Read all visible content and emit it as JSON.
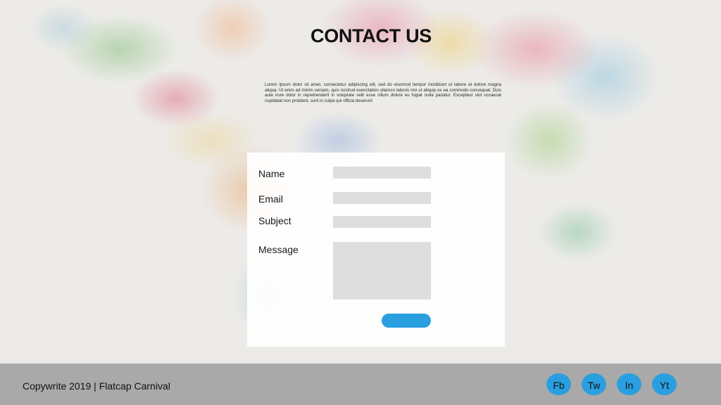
{
  "page": {
    "title": "CONTACT US",
    "intro": "Lorem ipsum dolor sit amet, consectetur adipiscing elit, sed do eiusmod tempor incididunt ut labore et dolore magna aliqua. Ut enim ad minim veniam, quis nostrud exercitation ullamco laboris nisi ut aliquip ex ea commodo consequat. Duis aute irure dolor in reprehenderit in voluptate velit esse cillum dolore eu fugiat nulla pariatur. Excepteur sint occaecat cupidatat non proident, sunt in culpa qui officia deserunt"
  },
  "form": {
    "name_label": "Name",
    "email_label": "Email",
    "subject_label": "Subject",
    "message_label": "Message",
    "name_value": "",
    "email_value": "",
    "subject_value": "",
    "message_value": "",
    "submit_label": ""
  },
  "footer": {
    "copyright": "Copywrite 2019 | Flatcap Carnival",
    "social": {
      "facebook": "Fb",
      "twitter": "Tw",
      "linkedin": "In",
      "youtube": "Yt"
    }
  },
  "colors": {
    "accent": "#2a9fe0",
    "footer_bg": "#a9a9a9",
    "field_bg": "#dedede"
  }
}
